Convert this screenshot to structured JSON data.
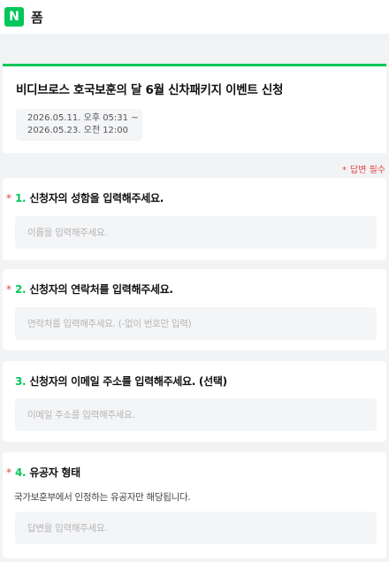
{
  "app": {
    "logo": "N",
    "title": "폼"
  },
  "form": {
    "title": "비디브로스 호국보훈의 달 6월 신차패키지 이벤트 신청",
    "period_start": "2026.05.11. 오후 05:31 ~",
    "period_end": "2026.05.23. 오전 12:00"
  },
  "required_note": {
    "star": "*",
    "text": "답변 필수"
  },
  "questions": [
    {
      "star": "*",
      "number": "1.",
      "title": "신청자의 성함을 입력해주세요.",
      "placeholder": "이름을 입력해주세요.",
      "value": ""
    },
    {
      "star": "*",
      "number": "2.",
      "title": "신청자의 연락처를 입력해주세요.",
      "placeholder": "연락처를 입력해주세요. (-없이 번호만 입력)",
      "value": ""
    },
    {
      "star": "",
      "number": "3.",
      "title": "신청자의 이메일 주소를 입력해주세요. (선택)",
      "placeholder": "이메일 주소를 입력해주세요.",
      "value": ""
    },
    {
      "star": "*",
      "number": "4.",
      "title": "유공자 형태",
      "description": "국가보훈부에서 인정하는 유공자만 해당됩니다.",
      "placeholder": "답변을 입력해주세요.",
      "value": ""
    }
  ],
  "colors": {
    "accent": "#03c75a",
    "required": "#e54545",
    "background": "#f2f3f5"
  }
}
